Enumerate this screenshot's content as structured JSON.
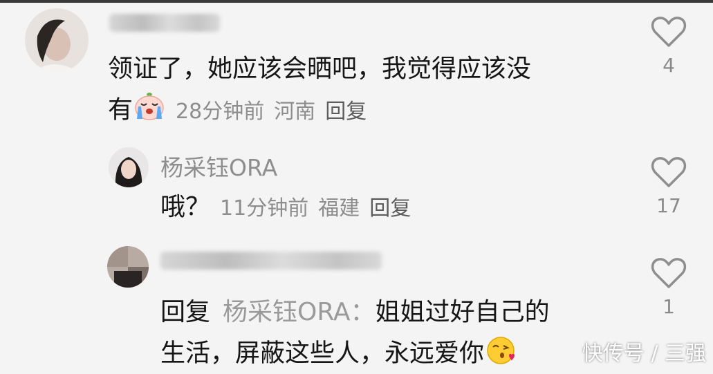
{
  "comments": [
    {
      "username": "",
      "text_line1": "领证了，她应该会晒吧，我觉得应该没",
      "text_line2": "有",
      "emoji": "crying-emoji",
      "time": "28分钟前",
      "location": "河南",
      "reply_label": "回复",
      "likes": "4"
    },
    {
      "username": "杨采钰ORA",
      "text": "哦？",
      "time": "11分钟前",
      "location": "福建",
      "reply_label": "回复",
      "likes": "17"
    },
    {
      "username": "",
      "reply_prefix": "回复",
      "reply_to": "杨采钰ORA",
      "reply_colon": "：",
      "text_line1": "姐姐过好自己的",
      "text_line2": "生活，屏蔽这些人，永远爱你",
      "emoji": "kissing-emoji",
      "likes": "1"
    }
  ],
  "watermark": "快传号 / 三强",
  "icons": {
    "like": "heart-outline-icon"
  },
  "colors": {
    "background": "#f4f4f4",
    "meta": "#8d8d8d",
    "text": "#161616"
  }
}
